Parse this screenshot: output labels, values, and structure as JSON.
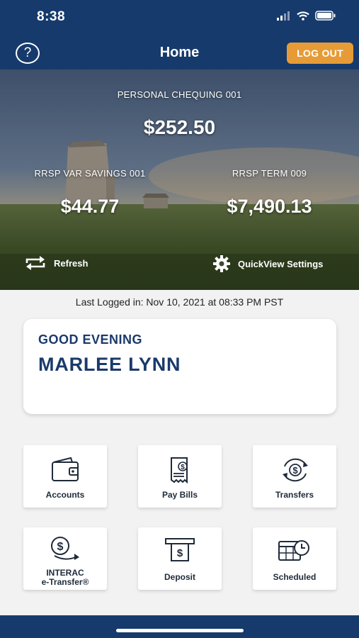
{
  "status": {
    "time": "8:38"
  },
  "header": {
    "help": "?",
    "title": "Home",
    "logout": "LOG OUT"
  },
  "accounts": [
    {
      "name": "PERSONAL CHEQUING 001",
      "balance": "$252.50"
    },
    {
      "name": "RRSP VAR SAVINGS 001",
      "balance": "$44.77"
    },
    {
      "name": "RRSP TERM 009",
      "balance": "$7,490.13"
    }
  ],
  "actions": {
    "refresh": "Refresh",
    "settings": "QuickView Settings"
  },
  "last_login": "Last Logged in: Nov 10, 2021 at 08:33 PM  PST",
  "greeting": {
    "salutation": "GOOD EVENING",
    "name": "MARLEE LYNN"
  },
  "tiles": [
    {
      "label": "Accounts",
      "icon": "wallet-icon"
    },
    {
      "label": "Pay Bills",
      "icon": "bill-icon"
    },
    {
      "label": "Transfers",
      "icon": "transfer-icon"
    },
    {
      "label_line1": "INTERAC",
      "label_line2": "e-Transfer®",
      "icon": "etransfer-icon"
    },
    {
      "label": "Deposit",
      "icon": "deposit-icon"
    },
    {
      "label": "Scheduled",
      "icon": "calendar-clock-icon"
    }
  ],
  "colors": {
    "navy": "#163a6c",
    "accent": "#e69b37",
    "text_dark": "#1a3a6b"
  }
}
